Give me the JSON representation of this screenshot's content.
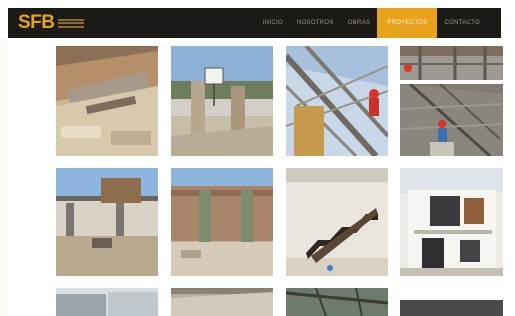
{
  "brand": {
    "logo_text": "SFB",
    "logo_name": "sfb-logo"
  },
  "nav": {
    "items": [
      {
        "label": "Inicio",
        "active": false
      },
      {
        "label": "Nosotros",
        "active": false
      },
      {
        "label": "Obras",
        "active": false
      },
      {
        "label": "Proyectos",
        "active": true
      },
      {
        "label": "Contacto",
        "active": false
      }
    ],
    "accent_color": "#e9a21c",
    "bar_color": "#1b1a17"
  },
  "gallery": {
    "photos": [
      {
        "name": "photo-rubble-pile"
      },
      {
        "name": "photo-pillars-sign"
      },
      {
        "name": "photo-steel-worker"
      },
      {
        "name": "photo-workers-tower"
      },
      {
        "name": "photo-house-frame"
      },
      {
        "name": "photo-columns-wall"
      },
      {
        "name": "photo-floating-stairs"
      },
      {
        "name": "photo-modern-house"
      },
      {
        "name": "photo-interior"
      },
      {
        "name": "photo-roof-view"
      },
      {
        "name": "photo-scaffold"
      }
    ]
  }
}
